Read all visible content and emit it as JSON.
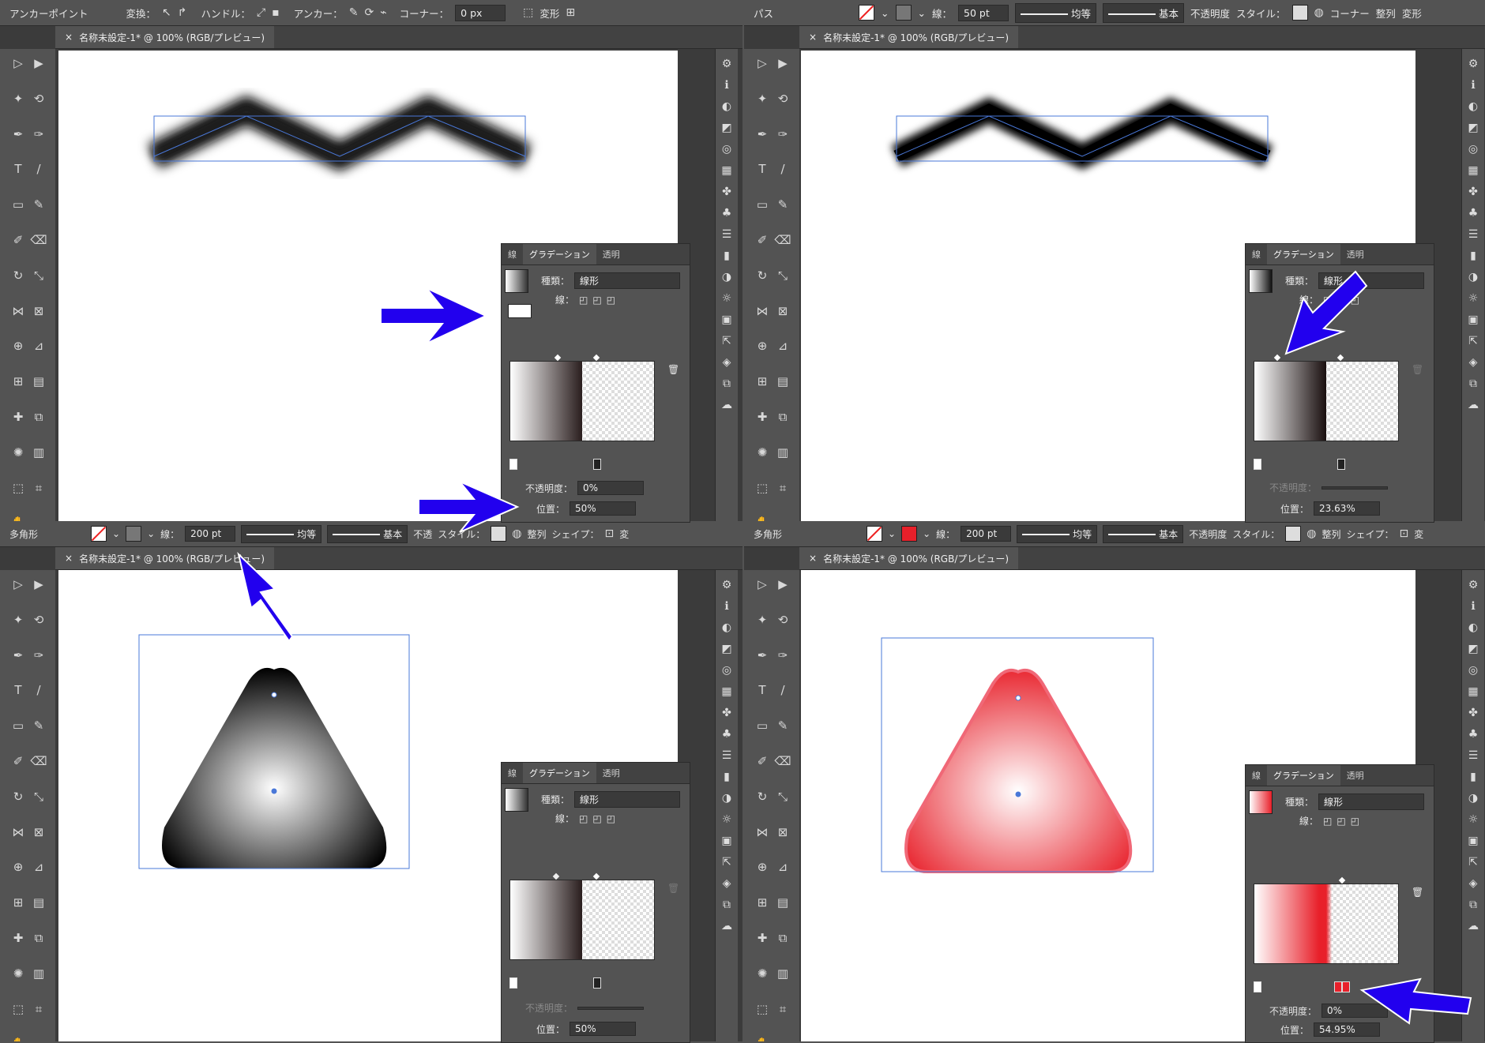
{
  "quadrants": [
    {
      "id": "q1",
      "control_bar": [
        "アンカーポイント",
        "変換：",
        "ハンドル：",
        "アンカー：",
        "コーナー：",
        "0 px",
        "変形"
      ],
      "doc_tab": "名称未設定-1* @ 100% (RGB/プレビュー)",
      "panel": {
        "tabs": [
          "線",
          "グラデーション",
          "透明"
        ],
        "type_label": "種類：",
        "type_value": "線形",
        "stroke_label": "線：",
        "opacity_label": "不透明度：",
        "opacity_value": "0%",
        "position_label": "位置：",
        "position_value": "50%"
      },
      "bottom_bar": [
        "多角形",
        "線：",
        "200 pt",
        "均等",
        "基本",
        "不透",
        "スタイル：",
        "整列",
        "シェイプ：",
        "変"
      ]
    },
    {
      "id": "q2",
      "control_bar": [
        "パス",
        "線：",
        "50 pt",
        "均等",
        "基本",
        "不透明度",
        "スタイル：",
        "コーナー",
        "整列",
        "変形"
      ],
      "doc_tab": "名称未設定-1* @ 100% (RGB/プレビュー)",
      "panel": {
        "tabs": [
          "線",
          "グラデーション",
          "透明"
        ],
        "type_label": "種類：",
        "type_value": "線形",
        "stroke_label": "線：",
        "opacity_label": "不透明度：",
        "opacity_value": "",
        "position_label": "位置：",
        "position_value": "23.63%"
      },
      "bottom_bar": [
        "多角形",
        "線：",
        "200 pt",
        "均等",
        "基本",
        "不透明度",
        "スタイル：",
        "整列",
        "シェイプ：",
        "変"
      ]
    },
    {
      "id": "q3",
      "doc_tab": "名称未設定-1* @ 100% (RGB/プレビュー)",
      "panel": {
        "tabs": [
          "線",
          "グラデーション",
          "透明"
        ],
        "type_label": "種類：",
        "type_value": "線形",
        "stroke_label": "線：",
        "opacity_label": "不透明度：",
        "opacity_value": "",
        "position_label": "位置：",
        "position_value": "50%"
      }
    },
    {
      "id": "q4",
      "doc_tab": "名称未設定-1* @ 100% (RGB/プレビュー)",
      "panel": {
        "tabs": [
          "線",
          "グラデーション",
          "透明"
        ],
        "type_label": "種類：",
        "type_value": "線形",
        "stroke_label": "線：",
        "opacity_label": "不透明度：",
        "opacity_value": "0%",
        "position_label": "位置：",
        "position_value": "54.95%"
      }
    }
  ],
  "colors": {
    "ui_dark": "#535353",
    "canvas": "#ffffff",
    "annotation_arrow": "#2200ee",
    "selection": "#4a78d8",
    "red_fill": "#e8202a"
  }
}
